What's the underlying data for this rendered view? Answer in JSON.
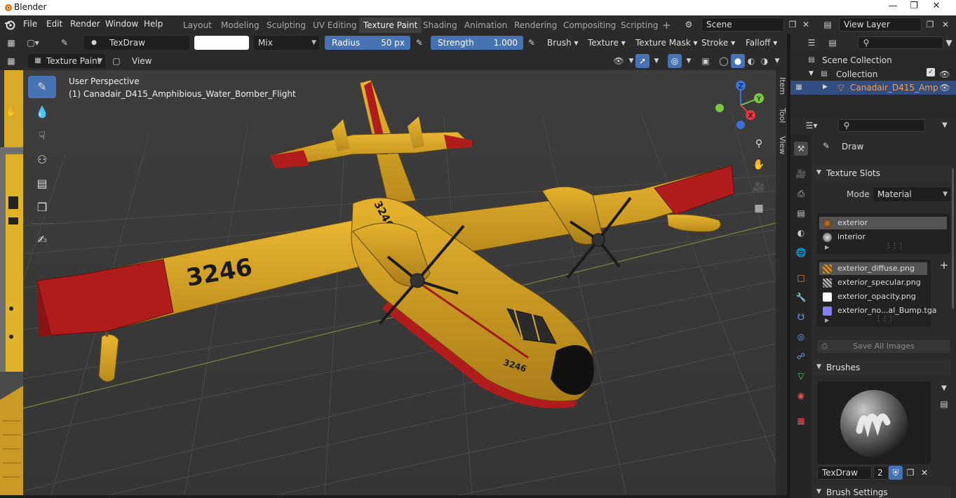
{
  "window": {
    "title": "Blender"
  },
  "menus": [
    "File",
    "Edit",
    "Render",
    "Window",
    "Help"
  ],
  "workspace_tabs": [
    {
      "label": "Layout"
    },
    {
      "label": "Modeling"
    },
    {
      "label": "Sculpting"
    },
    {
      "label": "UV Editing"
    },
    {
      "label": "Texture Paint",
      "active": true
    },
    {
      "label": "Shading"
    },
    {
      "label": "Animation"
    },
    {
      "label": "Rendering"
    },
    {
      "label": "Compositing"
    },
    {
      "label": "Scripting"
    }
  ],
  "scene": {
    "name": "Scene",
    "view_layer": "View Layer"
  },
  "tool_header": {
    "brush_name": "TexDraw",
    "blend_mode": "Mix",
    "radius_label": "Radius",
    "radius_value": "50 px",
    "strength_label": "Strength",
    "strength_value": "1.000",
    "dropdowns": [
      "Brush",
      "Texture",
      "Texture Mask",
      "Stroke",
      "Falloff"
    ]
  },
  "viewport_header": {
    "mode": "Texture Paint",
    "view_menu": "View"
  },
  "viewport": {
    "perspective_label": "User Perspective",
    "object_label": "(1) Canadair_D415_Amphibious_Water_Bomber_Flight",
    "tabs": [
      "Item",
      "Tool",
      "View"
    ],
    "gizmo_axes": {
      "x": "X",
      "y": "Y",
      "z": "Z"
    },
    "decals": {
      "wing_number": "3246",
      "tail_number": "3246",
      "nose_number": "3246"
    }
  },
  "outliner": {
    "items": [
      {
        "label": "Scene Collection"
      },
      {
        "label": "Collection"
      },
      {
        "label": "Canadair_D415_Amp"
      }
    ]
  },
  "properties": {
    "active_tool": "Draw",
    "texture_slots_title": "Texture Slots",
    "mode_label": "Mode",
    "mode_value": "Material",
    "materials": [
      {
        "label": "exterior",
        "selected": true
      },
      {
        "label": "interior",
        "selected": false
      }
    ],
    "images": [
      {
        "label": "exterior_diffuse.png",
        "selected": true,
        "color": "#c8922a"
      },
      {
        "label": "exterior_specular.png",
        "selected": false,
        "color": "#9a9a9a"
      },
      {
        "label": "exterior_opacity.png",
        "selected": false,
        "color": "#ffffff"
      },
      {
        "label": "exterior_no...al_Bump.tga",
        "selected": false,
        "color": "#8080ff"
      }
    ],
    "save_all": "Save All Images",
    "brushes_title": "Brushes",
    "brush_name": "TexDraw",
    "brush_users": "2",
    "brush_settings_title": "Brush Settings"
  },
  "colors": {
    "accent": "#4772b3",
    "plane_yellow": "#d9a92a",
    "plane_red": "#b01c1c",
    "axis_x": "#e0383e",
    "axis_y": "#7ac943",
    "axis_z": "#3b73d6"
  }
}
